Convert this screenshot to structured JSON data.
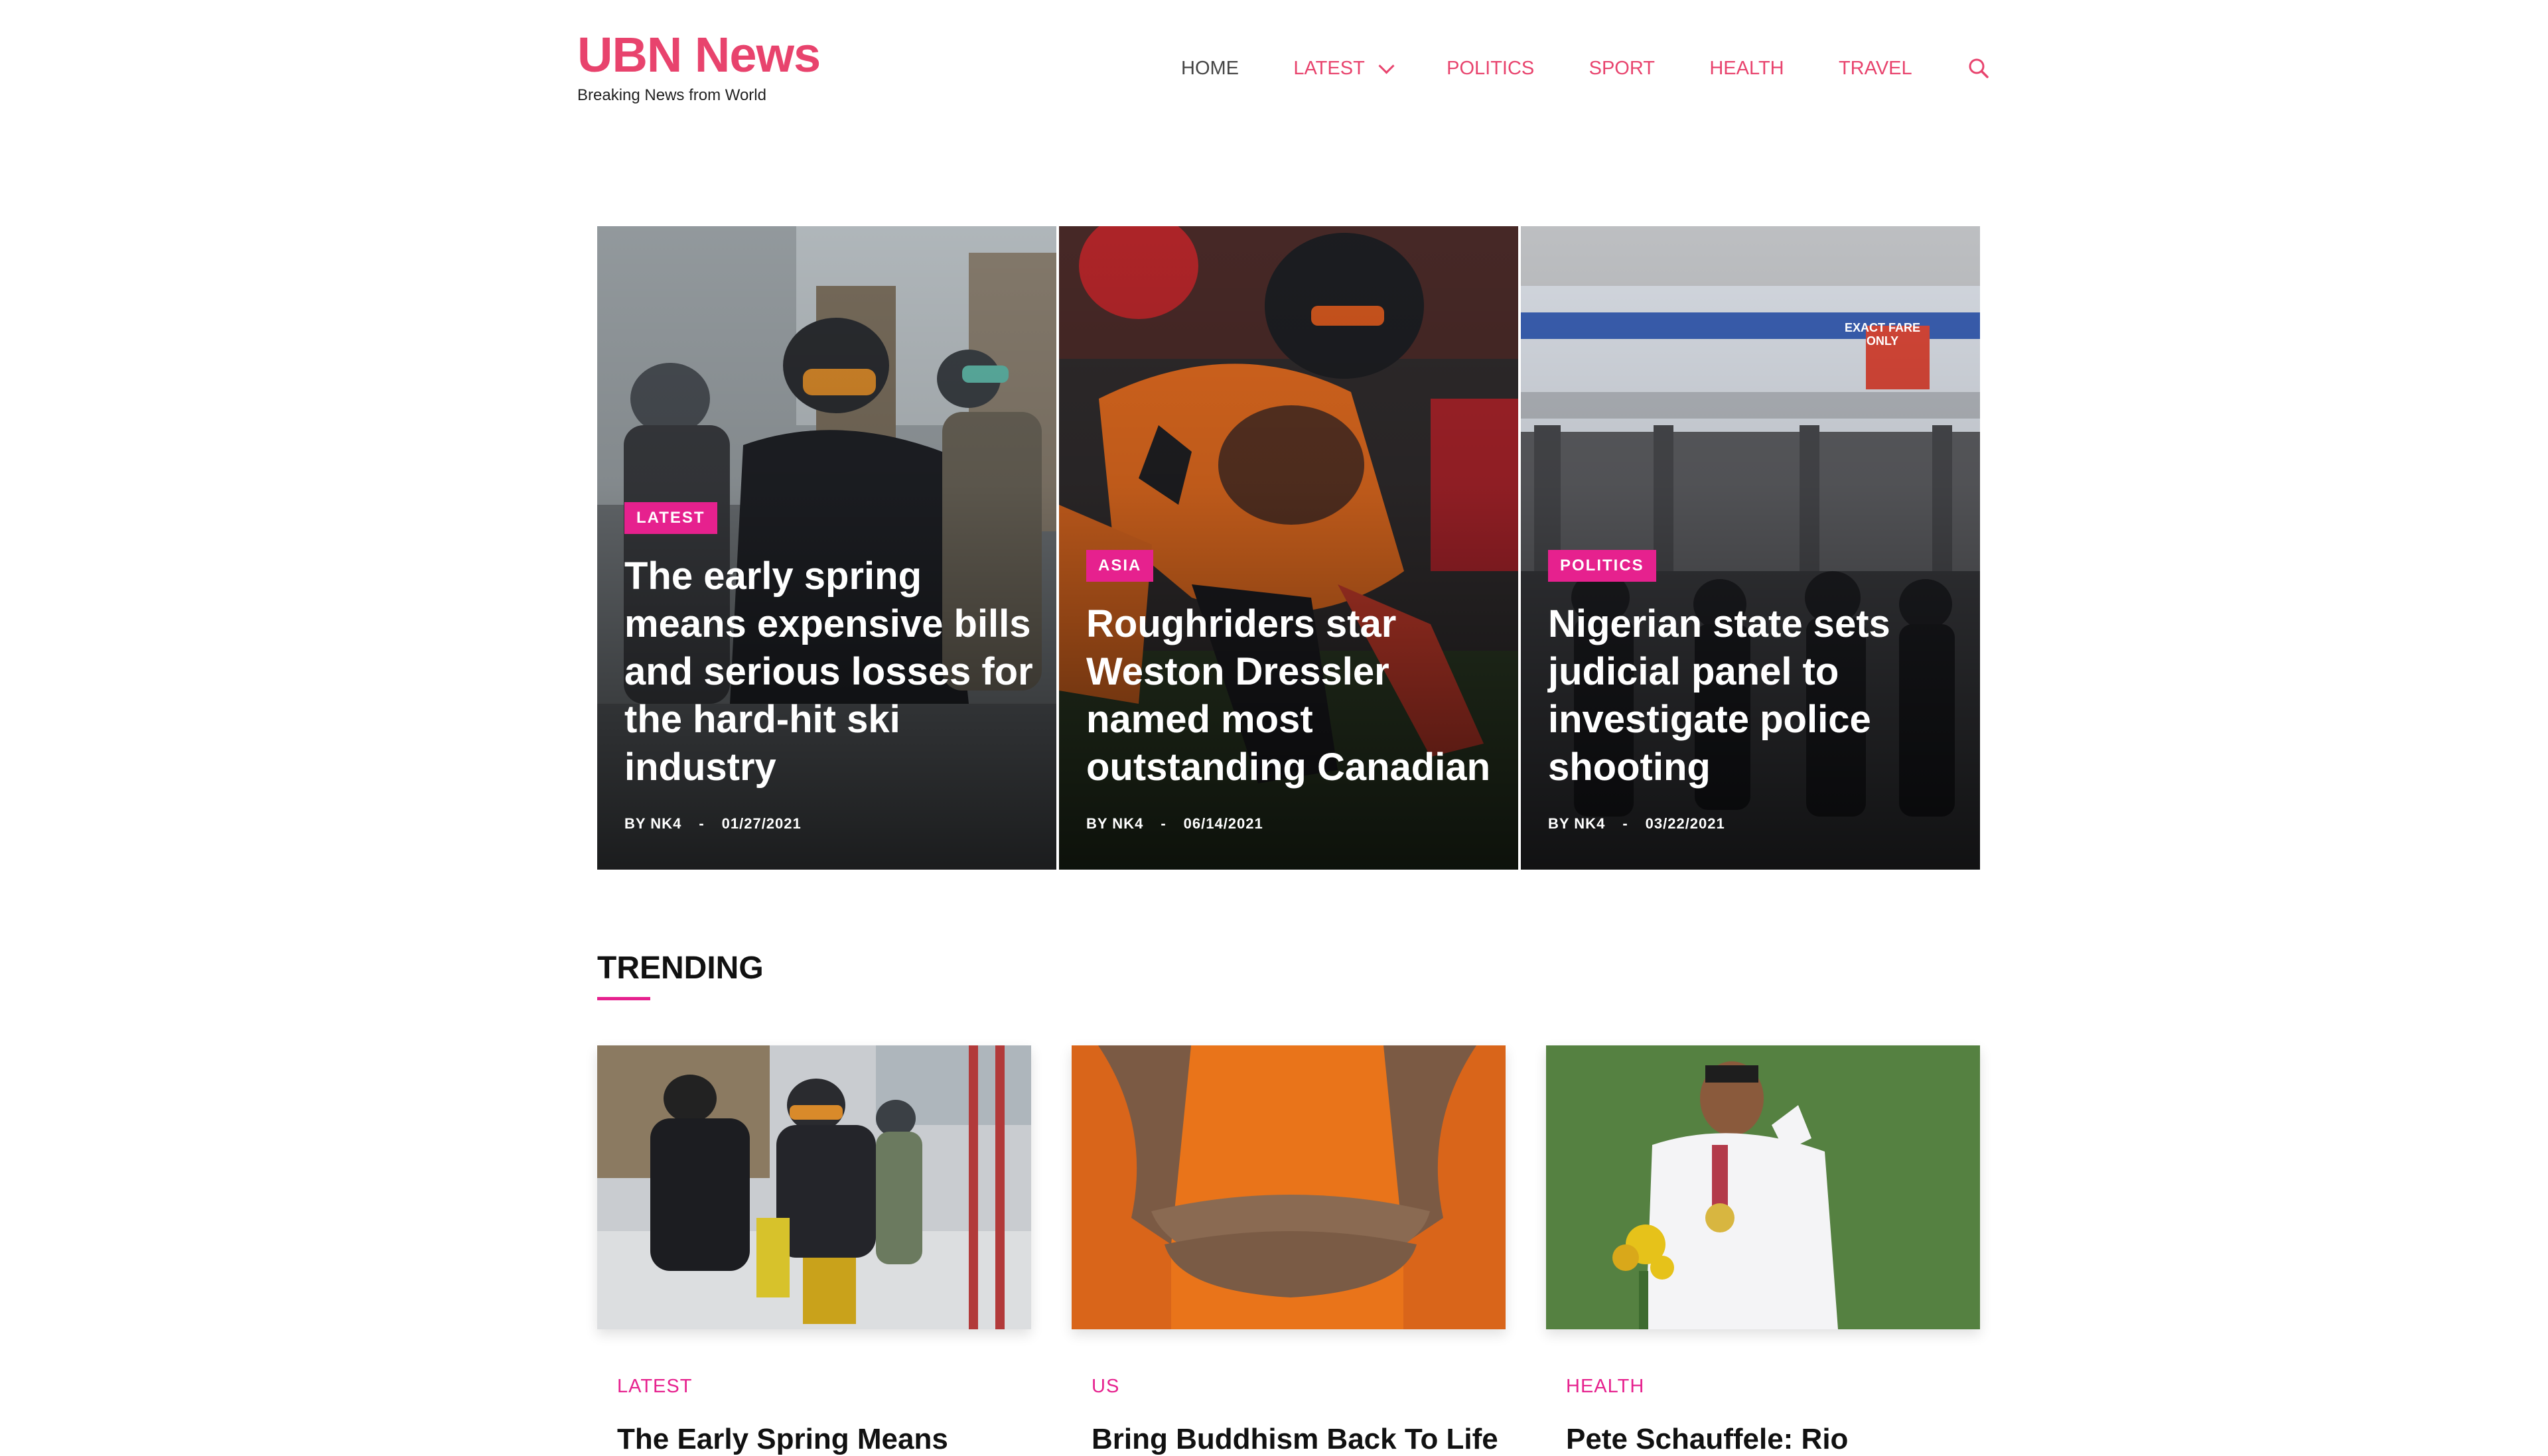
{
  "site": {
    "title": "UBN News",
    "tagline": "Breaking News from World"
  },
  "nav": {
    "items": [
      {
        "label": "HOME"
      },
      {
        "label": "LATEST"
      },
      {
        "label": "POLITICS"
      },
      {
        "label": "SPORT"
      },
      {
        "label": "HEALTH"
      },
      {
        "label": "TRAVEL"
      }
    ],
    "search_icon": "search-icon"
  },
  "hero": [
    {
      "tag": "LATEST",
      "title": "The early spring means expensive bills and serious losses for the hard-hit ski industry",
      "by": "BY",
      "author": "NK4",
      "sep": "-",
      "date": "01/27/2021"
    },
    {
      "tag": "ASIA",
      "title": "Roughriders star Weston Dressler named most outstanding Canadian",
      "by": "BY",
      "author": "NK4",
      "sep": "-",
      "date": "06/14/2021"
    },
    {
      "tag": "POLITICS",
      "title": "Nigerian state sets judicial panel to investigate police shooting",
      "by": "BY",
      "author": "NK4",
      "sep": "-",
      "date": "03/22/2021",
      "sign_text": "EXACT FARE ONLY"
    }
  ],
  "trending": {
    "heading": "TRENDING",
    "cards": [
      {
        "category": "LATEST",
        "title": "The Early Spring Means"
      },
      {
        "category": "US",
        "title": "Bring Buddhism Back To Life"
      },
      {
        "category": "HEALTH",
        "title": "Pete Schauffele: Rio"
      }
    ]
  },
  "colors": {
    "brand": "#e8436d",
    "tag_bg": "#e6218e",
    "heading": "#111111"
  }
}
